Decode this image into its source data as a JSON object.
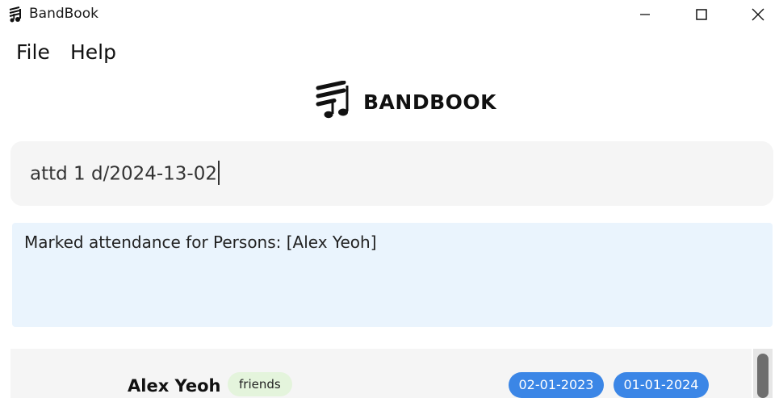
{
  "window": {
    "title": "BandBook"
  },
  "menu": {
    "file": "File",
    "help": "Help"
  },
  "logo": {
    "text": "BANDBOOK"
  },
  "command": {
    "value": "attd 1 d/2024-13-02"
  },
  "result": {
    "message": "Marked attendance for Persons: [Alex Yeoh]"
  },
  "persons": [
    {
      "name": "Alex Yeoh",
      "tags": [
        "friends"
      ],
      "attendance": [
        "02-01-2023",
        "01-01-2024"
      ]
    }
  ],
  "colors": {
    "tag_bg": "#e4f4dc",
    "attendance_badge": "#3b86e6",
    "result_bg": "#eaf4fd",
    "command_bg": "#f5f5f5"
  }
}
